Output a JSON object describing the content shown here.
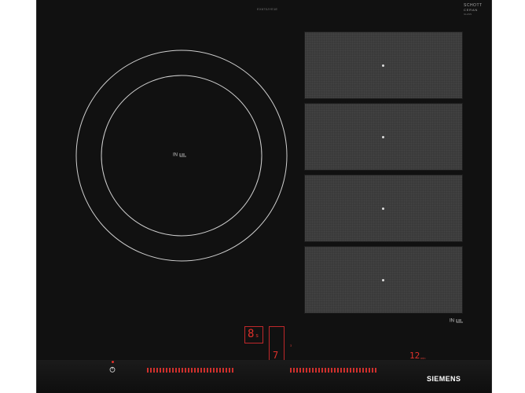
{
  "product": {
    "top_label": "EX675JYE1E",
    "glass_brand": "SCHOTT",
    "glass_sub": "CERAN",
    "glass_tiny": "GLASS",
    "brand": "SIEMENS",
    "induction_symbol_text": "IN"
  },
  "zones": {
    "round": "round-zone",
    "panels": [
      "zone-1",
      "zone-2",
      "zone-3",
      "zone-4"
    ]
  },
  "controls": {
    "display_left_a": "8",
    "display_left_b": "s",
    "display_middle": "7",
    "display_right": "12",
    "display_right_unit": "min",
    "display_right_small": "",
    "small_red_label": "3"
  },
  "colors": {
    "glass": "#111111",
    "zone_panel": "#3a3a3a",
    "display_red": "#e0312b",
    "brand_white": "#ffffff"
  },
  "icons": {
    "power": "power-icon",
    "coil": "induction-coil-icon",
    "dot": "zone-marker-icon"
  }
}
